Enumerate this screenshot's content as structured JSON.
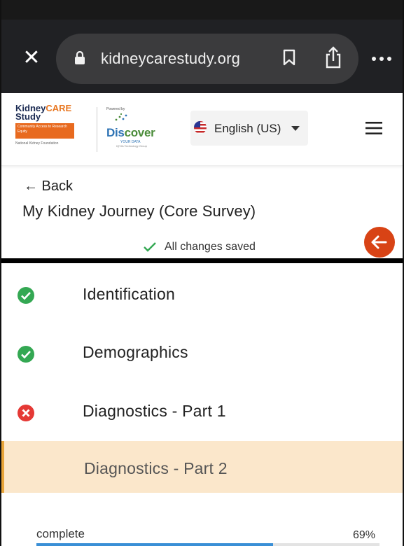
{
  "browser": {
    "url": "kidneycarestudy.org",
    "close_glyph": "✕",
    "icons": [
      "lock-icon",
      "bookmark-icon",
      "share-icon",
      "more-icon"
    ]
  },
  "site_header": {
    "logo_kidneycare": {
      "line1_a": "Kidney",
      "line1_b": "CARE",
      "line2": "Study",
      "tagline": "Community Access to Research Equity",
      "foot": "National Kidney Foundation"
    },
    "logo_discover": {
      "small": "Powered by",
      "title_a": "Dis",
      "title_b": "cover",
      "sub": "YOUR DATA",
      "foot": "IQVIA Technology Group"
    },
    "language": "English (US)",
    "menu_icon": "hamburger-icon"
  },
  "survey": {
    "back_label": "← Back",
    "title": "My Kidney Journey (Core Survey)",
    "save_status": "All changes saved",
    "back_fab_glyph": "←"
  },
  "sections": [
    {
      "label": "Identification",
      "status": "complete"
    },
    {
      "label": "Demographics",
      "status": "complete"
    },
    {
      "label": "Diagnostics - Part 1",
      "status": "error"
    },
    {
      "label": "Diagnostics - Part 2",
      "status": "current"
    }
  ],
  "progress": {
    "label": "complete",
    "value_text": "69%",
    "fraction": 0.69
  },
  "colors": {
    "complete": "#34a853",
    "error": "#e53935",
    "accent": "#d84315",
    "active_bg": "#fbe7cb"
  }
}
